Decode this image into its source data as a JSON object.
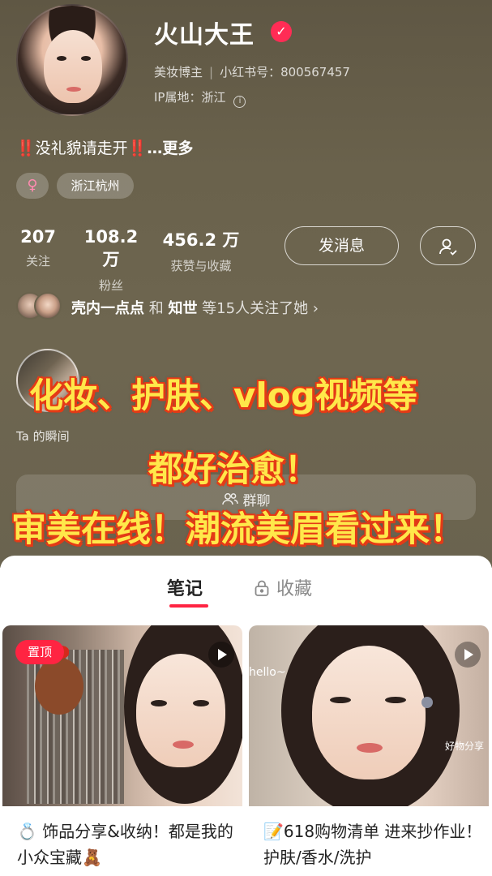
{
  "profile": {
    "name": "火山大王",
    "role": "美妆博主",
    "id_label": "小红书号：800567457",
    "ip_label": "IP属地：浙江",
    "bio_text": "没礼貌请走开",
    "bio_mark_left": "‼️",
    "bio_mark_right": "‼️",
    "bio_more": "…更多",
    "gender_symbol": "♀",
    "location_tag": "浙江杭州"
  },
  "stats": [
    {
      "value": "207",
      "label": "关注"
    },
    {
      "value": "108.2 万",
      "label": "粉丝"
    },
    {
      "value": "456.2 万",
      "label": "获赞与收藏"
    }
  ],
  "actions": {
    "message_label": "发消息"
  },
  "followers": {
    "name_a": "壳内一点点",
    "connector": " 和 ",
    "name_b": "知世",
    "suffix": " 等15人关注了她 ›"
  },
  "moments": {
    "label": "Ta 的瞬间"
  },
  "group": {
    "label": "群聊"
  },
  "overlay_text": {
    "line1": "化妆、护肤、vlog视频等",
    "line2": "都好治愈！",
    "line3": "审美在线！潮流美眉看过来！"
  },
  "tabs": {
    "notes": "笔记",
    "collections": "收藏"
  },
  "cards": [
    {
      "badge": "置顶",
      "title": "💍 饰品分享&收纳！都是我的小众宝藏🧸"
    },
    {
      "overlay_hello": "hello~",
      "overlay_goods": "好物分享",
      "title": "📝618购物清单 进来抄作业！护肤/香水/洗护"
    }
  ],
  "colors": {
    "accent": "#ff2442",
    "profile_bg": "#6a624c",
    "overlay_fill": "#ffe84a",
    "overlay_stroke": "#e43a16"
  },
  "icons": [
    "verified-icon",
    "info-icon",
    "add-friend-icon",
    "group-icon",
    "lock-icon",
    "play-icon"
  ]
}
